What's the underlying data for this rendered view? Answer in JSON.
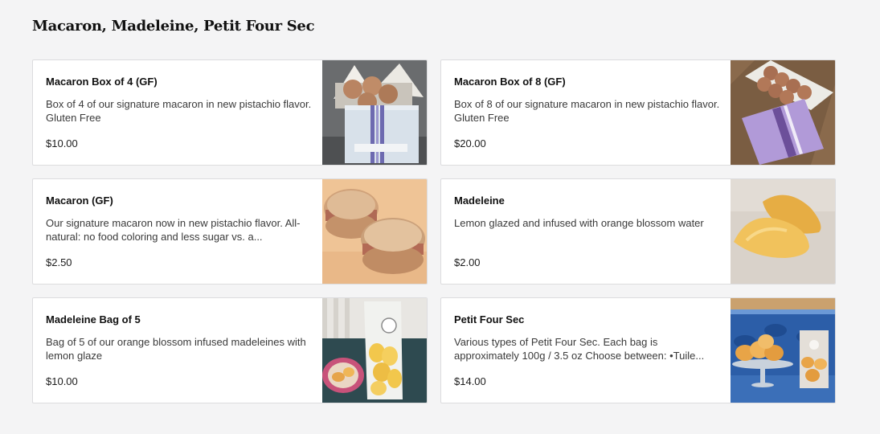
{
  "section": {
    "title": "Macaron, Madeleine, Petit Four Sec"
  },
  "items": [
    {
      "name": "Macaron Box of 4 (GF)",
      "description": "Box of 4 of our signature macaron in new pistachio flavor. Gluten Free",
      "price": "$10.00"
    },
    {
      "name": "Macaron Box of 8 (GF)",
      "description": "Box of 8 of our signature macaron in new pistachio flavor. Gluten Free",
      "price": "$20.00"
    },
    {
      "name": "Macaron (GF)",
      "description": "Our signature macaron now in new pistachio flavor. All-natural: no food coloring and less sugar vs. a...",
      "price": "$2.50"
    },
    {
      "name": "Madeleine",
      "description": "Lemon glazed and infused with orange blossom water",
      "price": "$2.00"
    },
    {
      "name": "Madeleine Bag of 5",
      "description": "Bag of 5 of our orange blossom infused madeleines with lemon glaze",
      "price": "$10.00"
    },
    {
      "name": "Petit Four Sec",
      "description": "Various types of Petit Four Sec. Each bag is approximately 100g / 3.5 oz Choose between: •Tuile...",
      "price": "$14.00"
    }
  ]
}
